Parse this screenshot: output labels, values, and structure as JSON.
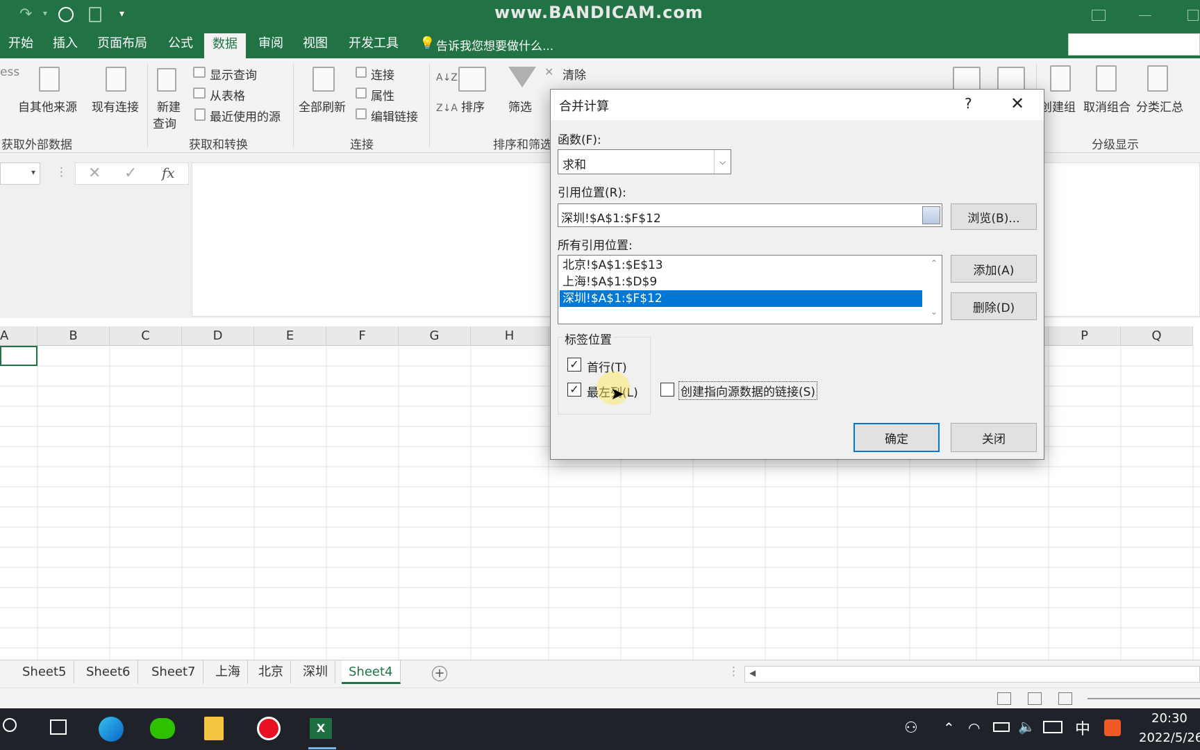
{
  "watermark": "www.BANDICAM.com",
  "ribbon_tabs": [
    "开始",
    "插入",
    "页面布局",
    "公式",
    "数据",
    "审阅",
    "视图",
    "开发工具"
  ],
  "tell_me": "告诉我您想要做什么...",
  "ribbon": {
    "partial_left": "ess",
    "other_sources": "自其他来源",
    "existing_conn": "现有连接",
    "new_query_1": "新建",
    "new_query_2": "查询",
    "show_queries": "显示查询",
    "from_table": "从表格",
    "recent_sources": "最近使用的源",
    "refresh_all": "全部刷新",
    "connections": "连接",
    "properties": "属性",
    "edit_links": "编辑链接",
    "sort": "排序",
    "filter": "筛选",
    "clear": "清除",
    "group": "创建组",
    "ungroup": "取消组合",
    "subtotal": "分类汇总",
    "grp_external": "获取外部数据",
    "grp_transform": "获取和转换",
    "grp_connections": "连接",
    "grp_sort": "排序和筛选",
    "grp_outline": "分级显示"
  },
  "columns": [
    "A",
    "B",
    "C",
    "D",
    "E",
    "F",
    "G",
    "H",
    "P",
    "Q"
  ],
  "sheets": [
    "Sheet5",
    "Sheet6",
    "Sheet7",
    "上海",
    "北京",
    "深圳",
    "Sheet4"
  ],
  "dialog": {
    "title": "合并计算",
    "help": "?",
    "function_label": "函数(F):",
    "function_value": "求和",
    "ref_label": "引用位置(R):",
    "ref_value": "深圳!$A$1:$F$12",
    "browse": "浏览(B)...",
    "all_refs_label": "所有引用位置:",
    "all_refs": [
      "北京!$A$1:$E$13",
      "上海!$A$1:$D$9",
      "深圳!$A$1:$F$12"
    ],
    "add": "添加(A)",
    "delete": "删除(D)",
    "labels_group": "标签位置",
    "top_row": "首行(T)",
    "left_col": "最左列(L)",
    "create_links": "创建指向源数据的链接(S)",
    "ok": "确定",
    "close": "关闭"
  },
  "taskbar": {
    "time": "20:30",
    "date": "2022/5/26",
    "ime": "中"
  }
}
